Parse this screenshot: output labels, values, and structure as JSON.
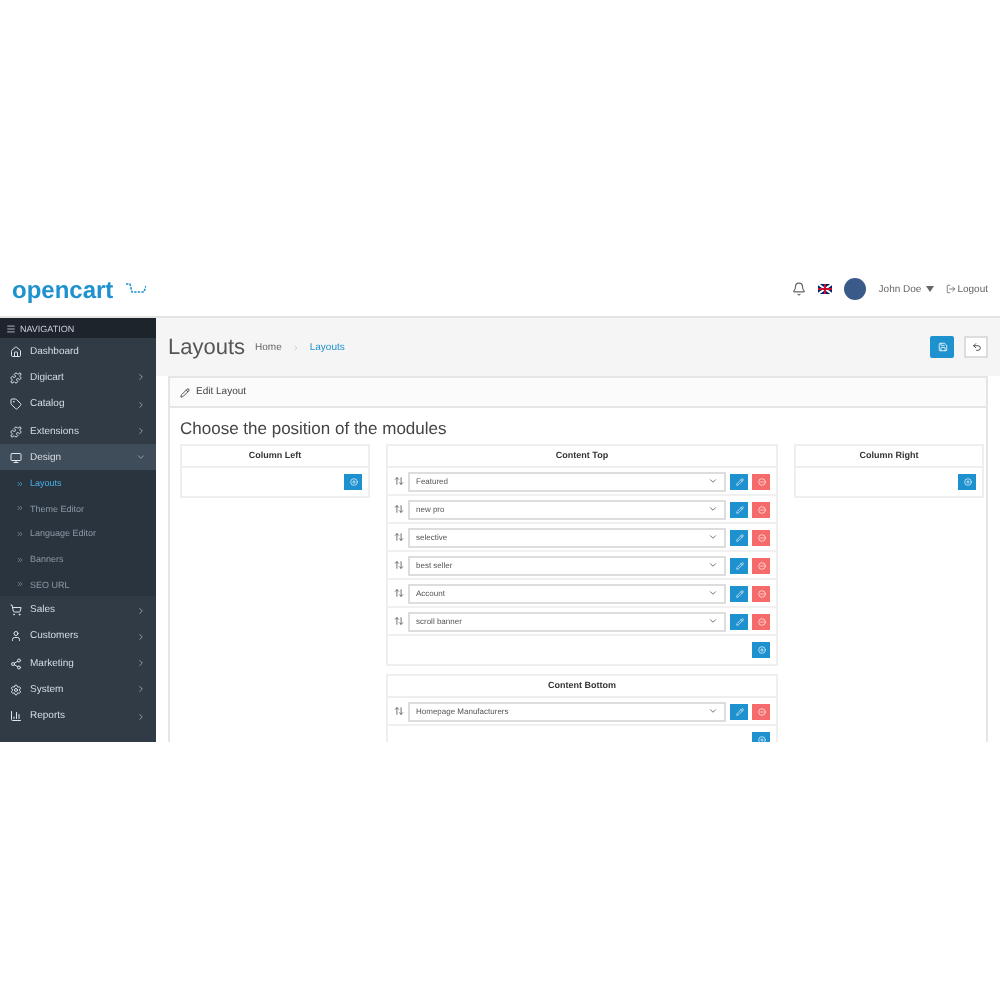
{
  "header": {
    "logo": "opencart",
    "user": "John Doe",
    "logout": "Logout"
  },
  "sidebar": {
    "title": "NAVIGATION",
    "items": [
      {
        "label": "Dashboard",
        "kind": "link"
      },
      {
        "label": "Digicart",
        "kind": "group",
        "expanded": false
      },
      {
        "label": "Catalog",
        "kind": "group",
        "expanded": false
      },
      {
        "label": "Extensions",
        "kind": "group",
        "expanded": false
      },
      {
        "label": "Design",
        "kind": "group",
        "expanded": true,
        "children": [
          {
            "label": "Layouts",
            "selected": true
          },
          {
            "label": "Theme Editor",
            "selected": false
          },
          {
            "label": "Language Editor",
            "selected": false
          },
          {
            "label": "Banners",
            "selected": false
          },
          {
            "label": "SEO URL",
            "selected": false
          }
        ]
      },
      {
        "label": "Sales",
        "kind": "group",
        "expanded": false
      },
      {
        "label": "Customers",
        "kind": "group",
        "expanded": false
      },
      {
        "label": "Marketing",
        "kind": "group",
        "expanded": false
      },
      {
        "label": "System",
        "kind": "group",
        "expanded": false
      },
      {
        "label": "Reports",
        "kind": "group",
        "expanded": false
      }
    ]
  },
  "page": {
    "title": "Layouts",
    "breadcrumb": [
      "Home",
      "Layouts"
    ]
  },
  "panel": {
    "heading": "Edit Layout",
    "title": "Choose the position of the modules",
    "columns": [
      {
        "positions": [
          {
            "name": "Column Left"
          }
        ]
      },
      {
        "positions": [
          {
            "name": "Content Top",
            "modules": [
              "Featured",
              "new pro",
              "selective",
              "best seller",
              "Account",
              "scroll banner"
            ]
          },
          {
            "name": "Content Bottom",
            "modules": [
              "Homepage Manufacturers"
            ]
          }
        ]
      },
      {
        "positions": [
          {
            "name": "Column Right"
          }
        ]
      }
    ]
  }
}
